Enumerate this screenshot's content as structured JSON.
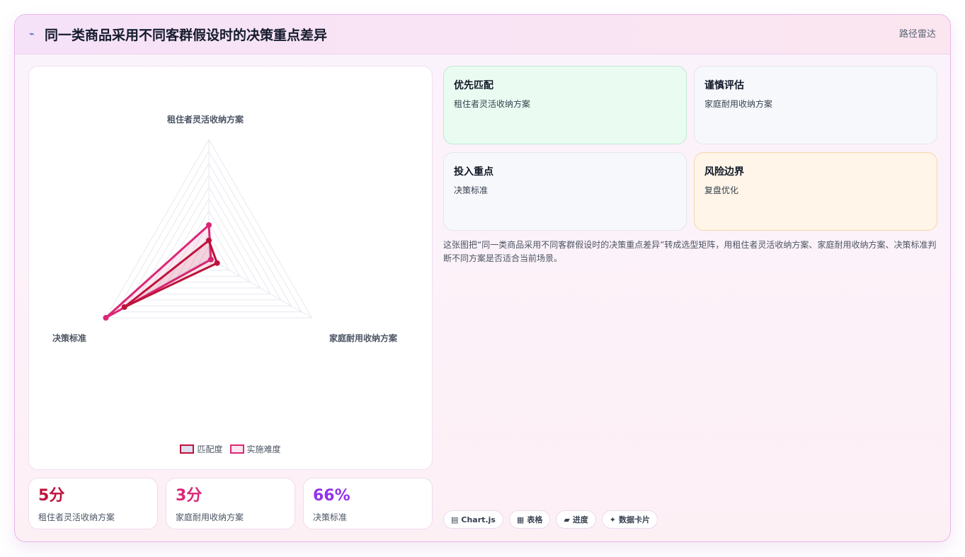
{
  "header": {
    "icon": "wave-icon",
    "title": "同一类商品采用不同客群假设时的决策重点差异",
    "tag": "路径雷达"
  },
  "chart_data": {
    "type": "radar",
    "axes": [
      "租住者灵活收纳方案",
      "家庭耐用收纳方案",
      "决策标准"
    ],
    "series": [
      {
        "name": "匹配度",
        "values": [
          15,
          8,
          82
        ],
        "color": "#be123c"
      },
      {
        "name": "实施难度",
        "values": [
          28,
          2,
          100
        ],
        "color": "#db2777"
      }
    ],
    "range": [
      0,
      100
    ]
  },
  "stats": [
    {
      "value": "5分",
      "label": "租住者灵活收纳方案",
      "color": "#be123c"
    },
    {
      "value": "3分",
      "label": "家庭耐用收纳方案",
      "color": "#db2777"
    },
    {
      "value": "66%",
      "label": "决策标准",
      "color": "#9333ea"
    }
  ],
  "tiles": [
    {
      "title": "优先匹配",
      "text": "租住者灵活收纳方案",
      "bg": "#eafcf1",
      "border": "#bfe9cf"
    },
    {
      "title": "谨慎评估",
      "text": "家庭耐用收纳方案",
      "bg": "#f7f8fb",
      "border": "#e3e6ef"
    },
    {
      "title": "投入重点",
      "text": "决策标准",
      "bg": "#f7f8fb",
      "border": "#e3e6ef"
    },
    {
      "title": "风险边界",
      "text": "复盘优化",
      "bg": "#fff5e8",
      "border": "#f5d7a8"
    }
  ],
  "description": "这张图把“同一类商品采用不同客群假设时的决策重点差异”转成选型矩阵，用租住者灵活收纳方案、家庭耐用收纳方案、决策标准判断不同方案是否适合当前场景。",
  "chips": [
    {
      "icon": "chart-icon",
      "glyph": "▤",
      "label": "Chart.js"
    },
    {
      "icon": "table-icon",
      "glyph": "▦",
      "label": "表格"
    },
    {
      "icon": "progress-icon",
      "glyph": "▰",
      "label": "进度"
    },
    {
      "icon": "sparkle-icon",
      "glyph": "✦",
      "label": "数据卡片"
    }
  ]
}
